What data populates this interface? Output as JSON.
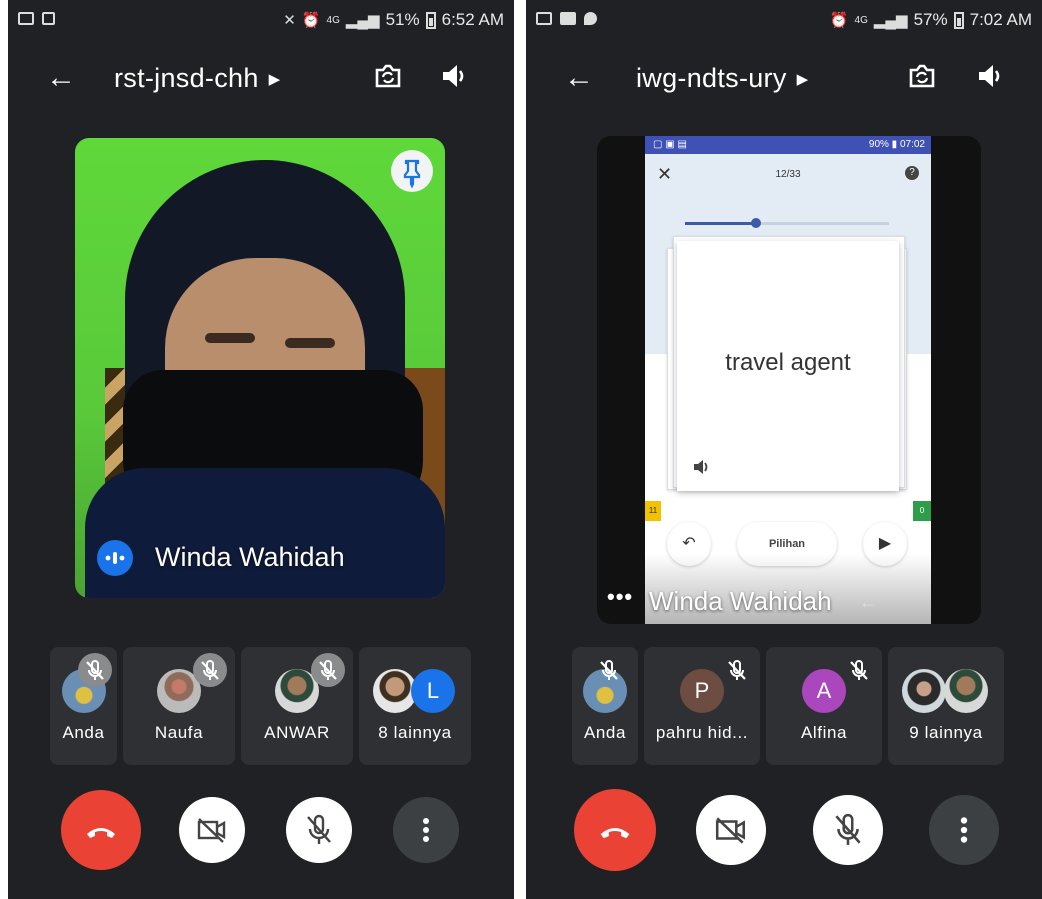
{
  "left": {
    "status": {
      "battery": "51%",
      "time": "6:52 AM",
      "network": "4G"
    },
    "meeting_code": "rst-jnsd-chh",
    "speaker": {
      "name": "Winda Wahidah"
    },
    "participants": [
      {
        "name": "Anda",
        "muted": true
      },
      {
        "name": "Naufa",
        "muted": true
      },
      {
        "name": "ANWAR",
        "muted": true
      },
      {
        "name": "8 lainnya",
        "avatar_letter": "L"
      }
    ],
    "colors": {
      "end_call": "#ea4335",
      "avatar_l": "#1a73e8"
    }
  },
  "right": {
    "status": {
      "battery": "57%",
      "time": "7:02 AM",
      "network": "4G"
    },
    "meeting_code": "iwg-ndts-ury",
    "shared_screen": {
      "status_battery": "90%",
      "status_time": "07:02",
      "progress_text": "12/33",
      "progress_fraction": 0.35,
      "card_text": "travel agent",
      "left_counter": "11",
      "right_counter": "0",
      "options_button": "Pilihan"
    },
    "speaker": {
      "name": "Winda Wahidah"
    },
    "participants": [
      {
        "name": "Anda",
        "muted": true
      },
      {
        "name": "pahru hid...",
        "avatar_letter": "P",
        "muted": true
      },
      {
        "name": "Alfina",
        "avatar_letter": "A",
        "muted": true
      },
      {
        "name": "9 lainnya"
      }
    ],
    "colors": {
      "avatar_p": "#6d4c41",
      "avatar_a": "#ab47bc"
    }
  }
}
